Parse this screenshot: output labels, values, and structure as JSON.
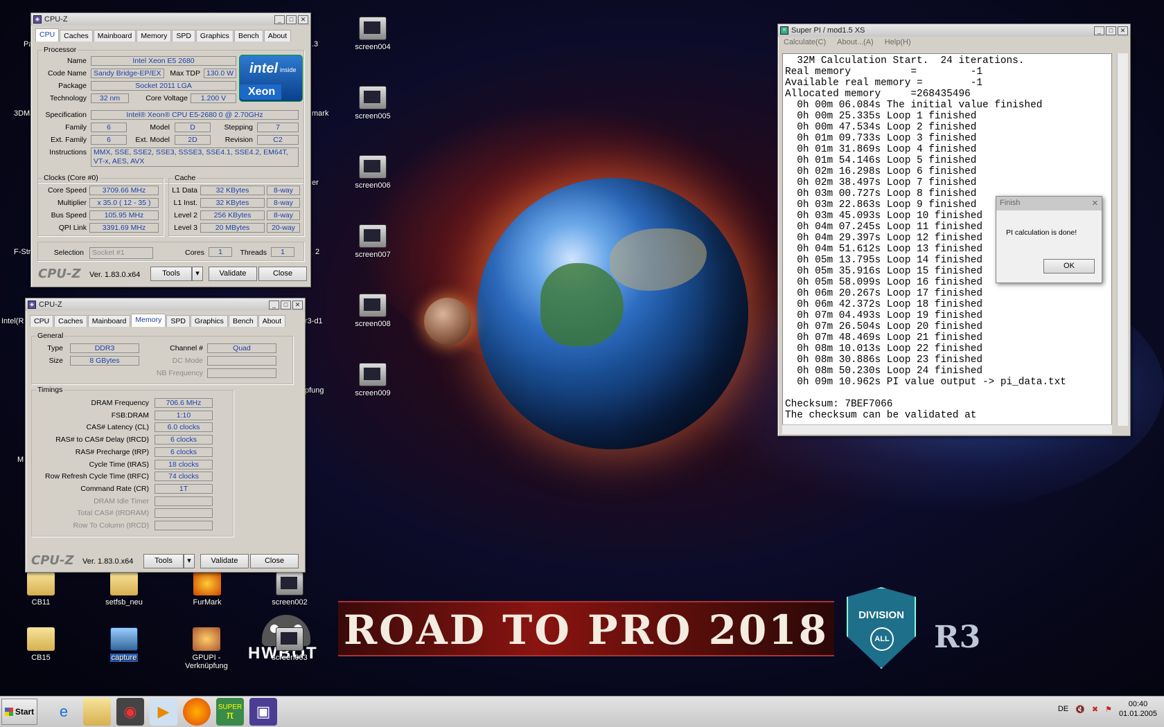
{
  "desktop": {
    "icons": [
      {
        "label": "screen004"
      },
      {
        "label": "screen005"
      },
      {
        "label": "screen006"
      },
      {
        "label": "screen007"
      },
      {
        "label": "screen008"
      },
      {
        "label": "screen009"
      },
      {
        "label": "CB11"
      },
      {
        "label": "setfsb_neu"
      },
      {
        "label": "FurMark"
      },
      {
        "label": "screen002"
      },
      {
        "label": "CB15"
      },
      {
        "label": "capture"
      },
      {
        "label": "GPUPI - Verknüpfung"
      },
      {
        "label": "screen003"
      }
    ],
    "edge_labels": [
      "Pa",
      "3DMa",
      "F-Str",
      "Intel(R",
      "M",
      "mark",
      "er",
      "2",
      "r3-d1",
      "pfung",
      ".3"
    ],
    "banner_text": "ROAD TO PRO 2018",
    "shield_text": "DIVISION",
    "shield_sub": "ALL",
    "r3_text": "R3",
    "hwbot_text": "HWBOT"
  },
  "cpuz1": {
    "title": "CPU-Z",
    "tabs": [
      "CPU",
      "Caches",
      "Mainboard",
      "Memory",
      "SPD",
      "Graphics",
      "Bench",
      "About"
    ],
    "selected_tab": "CPU",
    "processor_legend": "Processor",
    "labels": {
      "name": "Name",
      "code_name": "Code Name",
      "max_tdp": "Max TDP",
      "package": "Package",
      "technology": "Technology",
      "core_voltage": "Core Voltage",
      "specification": "Specification",
      "family": "Family",
      "model": "Model",
      "stepping": "Stepping",
      "ext_family": "Ext. Family",
      "ext_model": "Ext. Model",
      "revision": "Revision",
      "instructions": "Instructions"
    },
    "values": {
      "name": "Intel Xeon E5 2680",
      "code_name": "Sandy Bridge-EP/EX",
      "max_tdp": "130.0 W",
      "package": "Socket 2011 LGA",
      "technology": "32 nm",
      "core_voltage": "1.200 V",
      "specification": "Intel® Xeon® CPU E5-2680 0 @ 2.70GHz",
      "family": "6",
      "model": "D",
      "stepping": "7",
      "ext_family": "6",
      "ext_model": "2D",
      "revision": "C2",
      "instructions": "MMX, SSE, SSE2, SSE3, SSSE3, SSE4.1, SSE4.2, EM64T, VT-x, AES, AVX"
    },
    "intel_badge": {
      "brand": "intel",
      "inside": "inside",
      "product": "Xeon"
    },
    "clocks_legend": "Clocks (Core #0)",
    "clocks": [
      {
        "label": "Core Speed",
        "value": "3709.66 MHz"
      },
      {
        "label": "Multiplier",
        "value": "x 35.0 ( 12 - 35 )"
      },
      {
        "label": "Bus Speed",
        "value": "105.95 MHz"
      },
      {
        "label": "QPI Link",
        "value": "3391.69 MHz"
      }
    ],
    "cache_legend": "Cache",
    "cache": [
      {
        "label": "L1 Data",
        "size": "32 KBytes",
        "way": "8-way"
      },
      {
        "label": "L1 Inst.",
        "size": "32 KBytes",
        "way": "8-way"
      },
      {
        "label": "Level 2",
        "size": "256 KBytes",
        "way": "8-way"
      },
      {
        "label": "Level 3",
        "size": "20 MBytes",
        "way": "20-way"
      }
    ],
    "selection_label": "Selection",
    "selection_value": "Socket #1",
    "cores_label": "Cores",
    "cores_value": "1",
    "threads_label": "Threads",
    "threads_value": "1",
    "logo": "CPU-Z",
    "version": "Ver. 1.83.0.x64",
    "tools_label": "Tools",
    "validate_label": "Validate",
    "close_label": "Close"
  },
  "cpuz2": {
    "title": "CPU-Z",
    "tabs": [
      "CPU",
      "Caches",
      "Mainboard",
      "Memory",
      "SPD",
      "Graphics",
      "Bench",
      "About"
    ],
    "selected_tab": "Memory",
    "general_legend": "General",
    "type_label": "Type",
    "type_value": "DDR3",
    "size_label": "Size",
    "size_value": "8 GBytes",
    "channel_label": "Channel #",
    "channel_value": "Quad",
    "dc_mode_label": "DC Mode",
    "nb_freq_label": "NB Frequency",
    "timings_legend": "Timings",
    "timings": [
      {
        "label": "DRAM Frequency",
        "value": "706.6 MHz",
        "disabled": false
      },
      {
        "label": "FSB:DRAM",
        "value": "1:10",
        "disabled": false
      },
      {
        "label": "CAS# Latency (CL)",
        "value": "6.0 clocks",
        "disabled": false
      },
      {
        "label": "RAS# to CAS# Delay (tRCD)",
        "value": "6 clocks",
        "disabled": false
      },
      {
        "label": "RAS# Precharge (tRP)",
        "value": "6 clocks",
        "disabled": false
      },
      {
        "label": "Cycle Time (tRAS)",
        "value": "18 clocks",
        "disabled": false
      },
      {
        "label": "Row Refresh Cycle Time (tRFC)",
        "value": "74 clocks",
        "disabled": false
      },
      {
        "label": "Command Rate (CR)",
        "value": "1T",
        "disabled": false
      },
      {
        "label": "DRAM Idle Timer",
        "value": "",
        "disabled": true
      },
      {
        "label": "Total CAS# (tRDRAM)",
        "value": "",
        "disabled": true
      },
      {
        "label": "Row To Column (tRCD)",
        "value": "",
        "disabled": true
      }
    ],
    "logo": "CPU-Z",
    "version": "Ver. 1.83.0.x64",
    "tools_label": "Tools",
    "validate_label": "Validate",
    "close_label": "Close"
  },
  "superpi": {
    "title": "Super PI / mod1.5 XS",
    "menu": [
      "Calculate(C)",
      "About...(A)",
      "Help(H)"
    ],
    "lines": [
      "  32M Calculation Start.  24 iterations.",
      "Real memory          =         -1",
      "Available real memory =        -1",
      "Allocated memory     =268435496",
      "  0h 00m 06.084s The initial value finished",
      "  0h 00m 25.335s Loop 1 finished",
      "  0h 00m 47.534s Loop 2 finished",
      "  0h 01m 09.733s Loop 3 finished",
      "  0h 01m 31.869s Loop 4 finished",
      "  0h 01m 54.146s Loop 5 finished",
      "  0h 02m 16.298s Loop 6 finished",
      "  0h 02m 38.497s Loop 7 finished",
      "  0h 03m 00.727s Loop 8 finished",
      "  0h 03m 22.863s Loop 9 finished",
      "  0h 03m 45.093s Loop 10 finished",
      "  0h 04m 07.245s Loop 11 finished",
      "  0h 04m 29.397s Loop 12 finished",
      "  0h 04m 51.612s Loop 13 finished",
      "  0h 05m 13.795s Loop 14 finished",
      "  0h 05m 35.916s Loop 15 finished",
      "  0h 05m 58.099s Loop 16 finished",
      "  0h 06m 20.267s Loop 17 finished",
      "  0h 06m 42.372s Loop 18 finished",
      "  0h 07m 04.493s Loop 19 finished",
      "  0h 07m 26.504s Loop 20 finished",
      "  0h 07m 48.469s Loop 21 finished",
      "  0h 08m 10.013s Loop 22 finished",
      "  0h 08m 30.886s Loop 23 finished",
      "  0h 08m 50.230s Loop 24 finished",
      "  0h 09m 10.962s PI value output -> pi_data.txt",
      "",
      "Checksum: 7BEF7066",
      "The checksum can be validated at"
    ]
  },
  "finish_dialog": {
    "title": "Finish",
    "message": "PI calculation is done!",
    "ok_label": "OK"
  },
  "taskbar": {
    "start_label": "Start",
    "language": "DE",
    "time": "00:40",
    "date": "01.01.2005",
    "pinned": [
      "ie-icon",
      "explorer-icon",
      "cpu-tool-icon",
      "media-player-icon",
      "firefox-icon",
      "superpi-icon",
      "cpuz-icon"
    ],
    "superpi_short": "SUPER"
  }
}
